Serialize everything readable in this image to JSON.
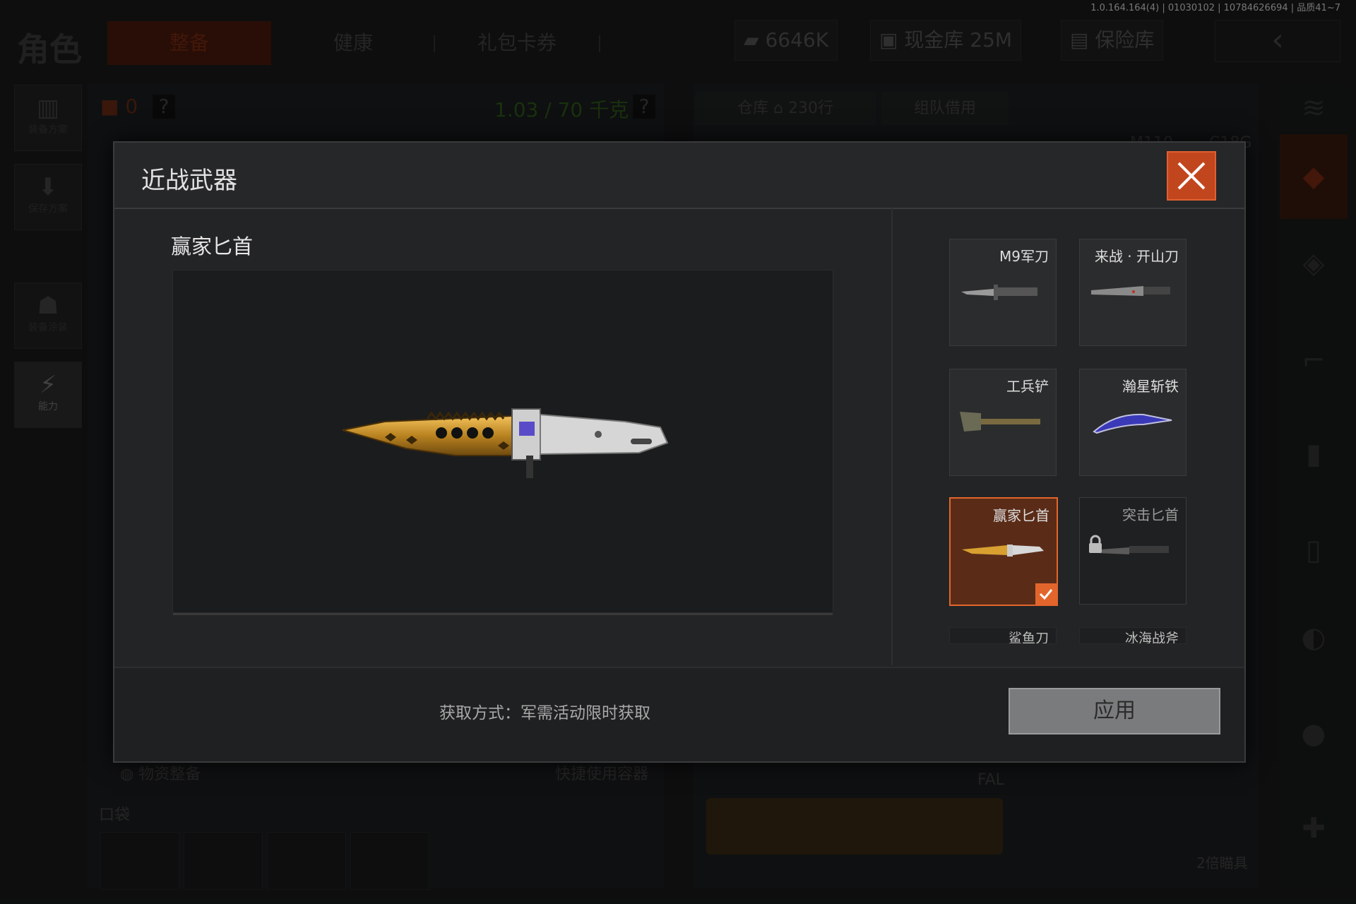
{
  "version_info": "1.0.164.164(4) | 01030102 | 10784626694 | 品质41~7",
  "screen_title": "角色",
  "top_tabs": [
    "整备",
    "健康",
    "礼包卡券"
  ],
  "currencies": {
    "coins": "6646K",
    "cash_depot": "现金库 25M",
    "safe_box": "保险库"
  },
  "sidebar": [
    {
      "label": "装备方案",
      "icon": "vest-icon"
    },
    {
      "label": "保存方案",
      "icon": "download-icon"
    },
    {
      "label": "装备涂装",
      "icon": "helmet-icon"
    },
    {
      "label": "能力",
      "icon": "ability-icon"
    }
  ],
  "loadout": {
    "backpack_count": "0",
    "weight": "1.03 / 70 千克",
    "help": "?"
  },
  "depot": {
    "tab_label": "仓库",
    "rows": "230行",
    "team_borrow": "组队借用",
    "bg_labels": [
      "M110",
      "C18G",
      "FAL",
      "2倍瞄具"
    ]
  },
  "bottom": {
    "supplies": "物资整备",
    "quick_use": "快捷使用容器",
    "pocket": "口袋"
  },
  "modal": {
    "title": "近战武器",
    "selected_name": "赢家匕首",
    "acquire_text": "获取方式：军需活动限时获取",
    "apply_label": "应用",
    "items": [
      {
        "name": "M9军刀",
        "state": "normal",
        "icon": "bayonet-icon"
      },
      {
        "name": "来战 · 开山刀",
        "state": "normal",
        "icon": "machete-icon"
      },
      {
        "name": "工兵铲",
        "state": "normal",
        "icon": "shovel-icon"
      },
      {
        "name": "瀚星斩铁",
        "state": "normal",
        "icon": "karambit-icon"
      },
      {
        "name": "赢家匕首",
        "state": "selected",
        "icon": "gold-dagger-icon"
      },
      {
        "name": "突击匕首",
        "state": "locked",
        "icon": "assault-dagger-icon"
      },
      {
        "name": "鲨鱼刀",
        "state": "partial",
        "icon": ""
      },
      {
        "name": "冰海战斧",
        "state": "partial",
        "icon": ""
      }
    ]
  },
  "colors": {
    "accent": "#e2652c",
    "close_bg": "#c2461d",
    "weight_text": "#2f5a1a"
  }
}
